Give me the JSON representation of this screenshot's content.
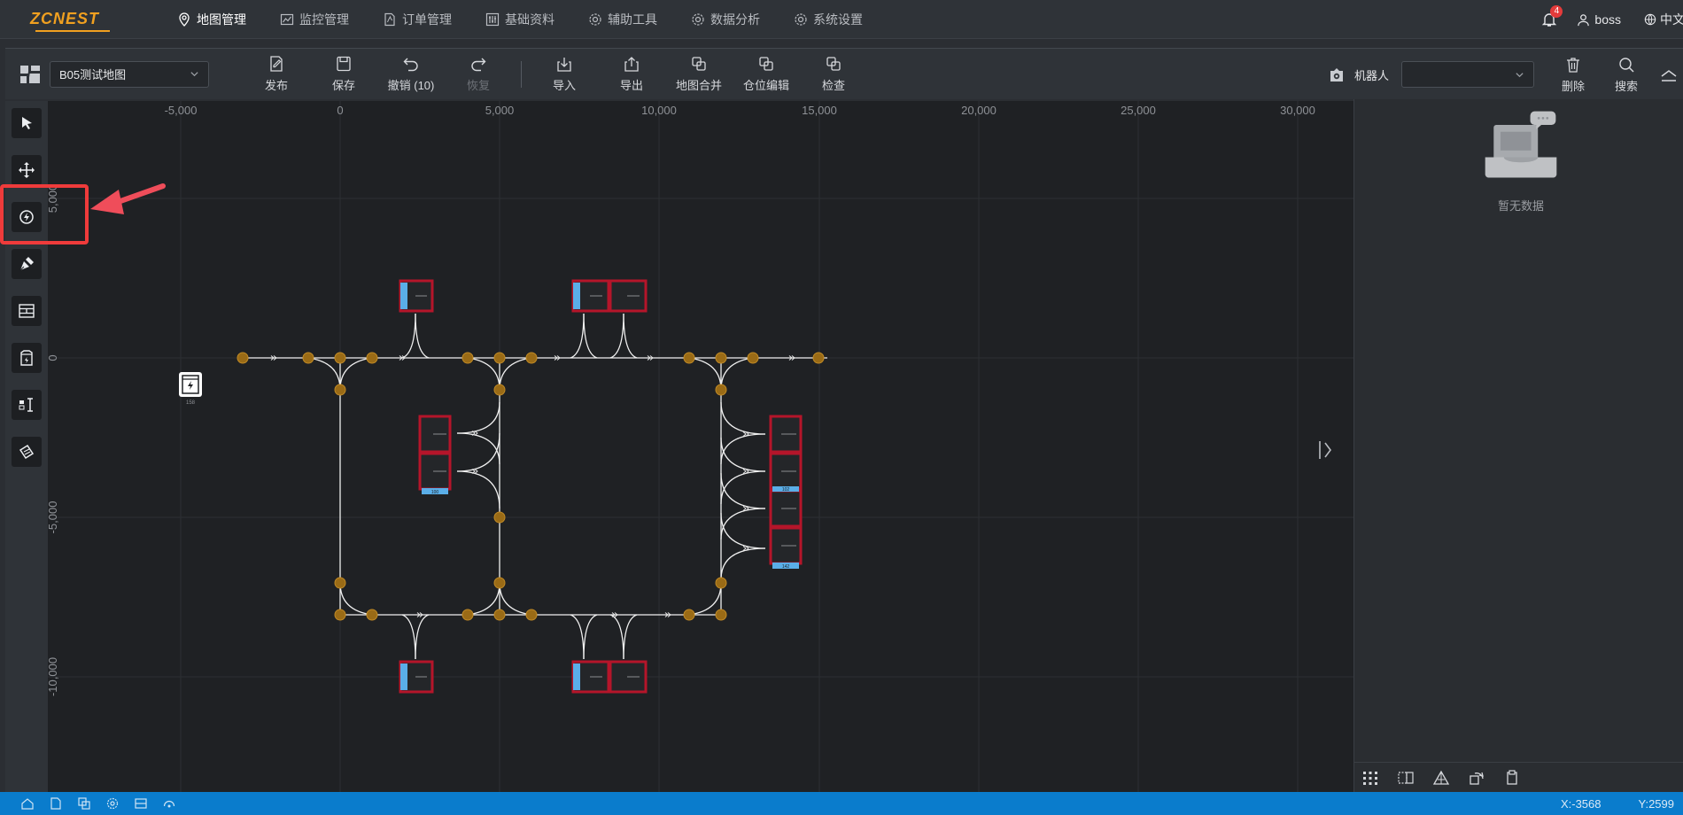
{
  "app": {
    "logo": "ZCNEST"
  },
  "nav": {
    "items": [
      {
        "label": "地图管理",
        "icon": "map-pin-icon",
        "active": true
      },
      {
        "label": "监控管理",
        "icon": "monitor-chart-icon",
        "active": false
      },
      {
        "label": "订单管理",
        "icon": "document-icon",
        "active": false
      },
      {
        "label": "基础资料",
        "icon": "sliders-icon",
        "active": false
      },
      {
        "label": "辅助工具",
        "icon": "gear-icon",
        "active": false
      },
      {
        "label": "数据分析",
        "icon": "gear-icon",
        "active": false
      },
      {
        "label": "系统设置",
        "icon": "gear-icon",
        "active": false
      }
    ]
  },
  "header": {
    "notifications": "4",
    "user": "boss",
    "lang": "中文"
  },
  "toolbar": {
    "map_name": "B05测试地图",
    "buttons": [
      {
        "label": "发布",
        "icon": "publish-icon"
      },
      {
        "label": "保存",
        "icon": "save-icon"
      },
      {
        "label": "撤销 (10)",
        "icon": "undo-icon"
      },
      {
        "label": "恢复",
        "icon": "redo-icon",
        "disabled": true
      },
      {
        "label": "导入",
        "icon": "import-icon"
      },
      {
        "label": "导出",
        "icon": "export-icon"
      },
      {
        "label": "地图合并",
        "icon": "merge-icon"
      },
      {
        "label": "仓位编辑",
        "icon": "copy-icon"
      },
      {
        "label": "检查",
        "icon": "check-icon"
      }
    ],
    "robot_label": "机器人",
    "robot_value": "",
    "delete_label": "删除",
    "search_label": "搜索"
  },
  "axes": {
    "x_ticks": [
      "-5,000",
      "0",
      "5,000",
      "10,000",
      "15,000",
      "20,000",
      "25,000",
      "30,000"
    ],
    "y_ticks": [
      "5,000",
      "0",
      "-5,000",
      "-10,000"
    ]
  },
  "panel": {
    "empty_text": "暂无数据"
  },
  "map_labels": {
    "charger": "158",
    "bin_left": "100",
    "bin_right_mid": "102",
    "bin_right_bottom": "142"
  },
  "status": {
    "x": "X:-3568",
    "y": "Y:2599"
  },
  "colors": {
    "accent": "#0a7ccc",
    "node": "#b07c1a",
    "bin_border": "#b5152a",
    "bin_tag": "#5aaee8",
    "highlight": "#ef3b3b"
  }
}
